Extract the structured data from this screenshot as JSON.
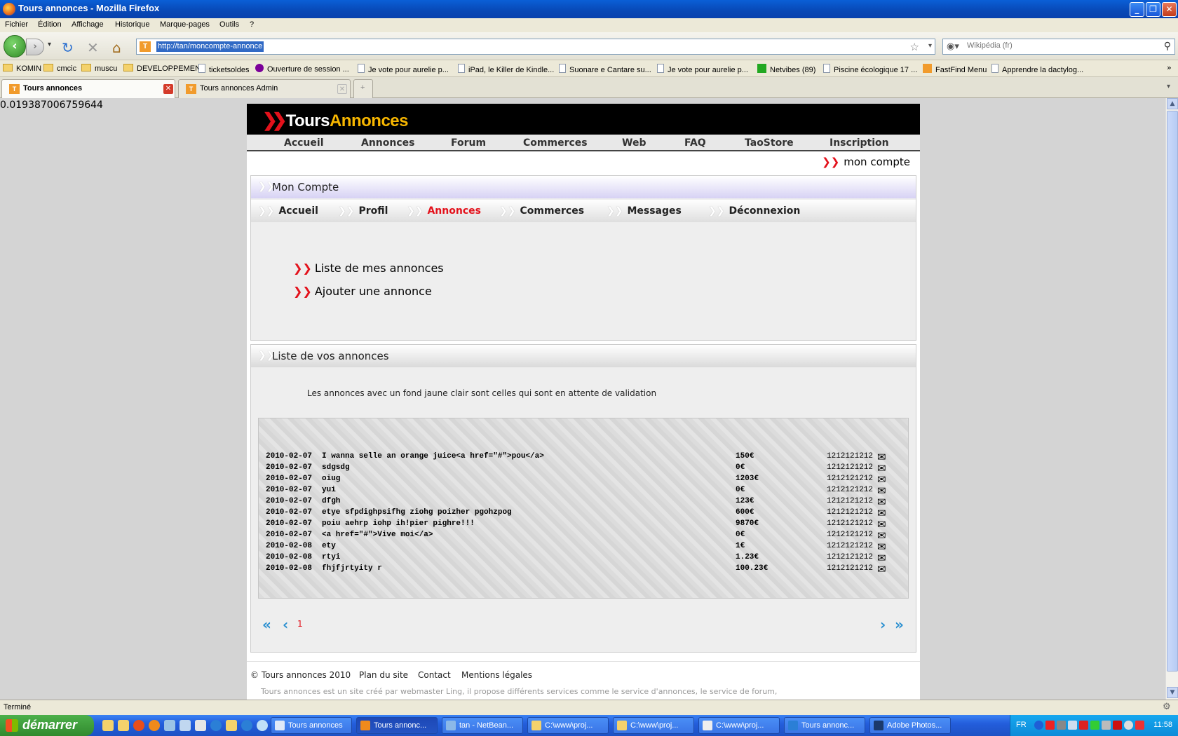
{
  "window": {
    "title": "Tours annonces - Mozilla Firefox"
  },
  "menu": [
    "Fichier",
    "Édition",
    "Affichage",
    "Historique",
    "Marque-pages",
    "Outils",
    "?"
  ],
  "nav": {
    "url": "http://tan/moncompte-annonce",
    "search_placeholder": "Wikipédia (fr)"
  },
  "bookmarks": [
    {
      "label": "KOMIN",
      "icon": "folder"
    },
    {
      "label": "cmcic",
      "icon": "folder"
    },
    {
      "label": "muscu",
      "icon": "folder"
    },
    {
      "label": "DEVELOPPEMENT",
      "icon": "folder"
    },
    {
      "label": "ticketsoldes",
      "icon": "page"
    },
    {
      "label": "Ouverture de session ...",
      "icon": "yahoo"
    },
    {
      "label": "Je vote pour aurelie p...",
      "icon": "page"
    },
    {
      "label": "iPad, le Killer de Kindle...",
      "icon": "page"
    },
    {
      "label": "Suonare e Cantare su...",
      "icon": "page"
    },
    {
      "label": "Je vote pour aurelie p...",
      "icon": "page"
    },
    {
      "label": "Netvibes (89)",
      "icon": "plus"
    },
    {
      "label": "Piscine écologique 17 ...",
      "icon": "page"
    },
    {
      "label": "FastFind Menu",
      "icon": "tour"
    },
    {
      "label": "Apprendre la dactylog...",
      "icon": "page"
    }
  ],
  "tabs": [
    {
      "label": "Tours annonces",
      "active": true
    },
    {
      "label": "Tours annonces Admin",
      "active": false
    }
  ],
  "debug_value": "0.019387006759644",
  "site": {
    "logo_part1": "Tours",
    "logo_part2": "Annonces",
    "nav": [
      "Accueil",
      "Annonces",
      "Forum",
      "Commerces",
      "Web",
      "FAQ",
      "TaoStore",
      "Inscription"
    ],
    "mon_compte": "mon compte",
    "account_title": "Mon Compte",
    "subnav": [
      {
        "label": "Accueil",
        "active": false
      },
      {
        "label": "Profil",
        "active": false
      },
      {
        "label": "Annonces",
        "active": true
      },
      {
        "label": "Commerces",
        "active": false
      },
      {
        "label": "Messages",
        "active": false
      },
      {
        "label": "Déconnexion",
        "active": false
      }
    ],
    "links": [
      "Liste de mes annonces",
      "Ajouter une annonce"
    ],
    "list_title": "Liste de vos annonces",
    "list_note": "Les annonces avec un fond jaune clair sont celles qui sont en attente de validation",
    "ads": [
      {
        "date": "2010-02-07",
        "title": "I wanna selle an orange juice<a href=\"#\">pou</a>",
        "price": "150€",
        "phone": "1212121212"
      },
      {
        "date": "2010-02-07",
        "title": "sdgsdg",
        "price": "0€",
        "phone": "1212121212"
      },
      {
        "date": "2010-02-07",
        "title": "oiug",
        "price": "1203€",
        "phone": "1212121212"
      },
      {
        "date": "2010-02-07",
        "title": "yui",
        "price": "0€",
        "phone": "1212121212"
      },
      {
        "date": "2010-02-07",
        "title": "dfgh",
        "price": "123€",
        "phone": "1212121212"
      },
      {
        "date": "2010-02-07",
        "title": "etye sfpdighpsifhg ziohg poizher pgohzpog",
        "price": "600€",
        "phone": "1212121212"
      },
      {
        "date": "2010-02-07",
        "title": "poiu aehrp iohp ih!pier pighre!!!",
        "price": "9870€",
        "phone": "1212121212"
      },
      {
        "date": "2010-02-07",
        "title": "<a href=\"#\">Vive moi</a>",
        "price": "0€",
        "phone": "1212121212"
      },
      {
        "date": "2010-02-08",
        "title": "ety",
        "price": "1€",
        "phone": "1212121212"
      },
      {
        "date": "2010-02-08",
        "title": "rtyi",
        "price": "1.23€",
        "phone": "1212121212"
      },
      {
        "date": "2010-02-08",
        "title": "fhjfjrtyity r",
        "price": "100.23€",
        "phone": "1212121212"
      }
    ],
    "pager": {
      "first": "«",
      "prev": "‹",
      "page": "1",
      "next": "›",
      "last": "»"
    },
    "footer": {
      "copyright": "© Tours annonces 2010",
      "links": [
        "Plan du site",
        "Contact",
        "Mentions légales"
      ],
      "note": "Tours annonces est un site créé par webmaster Ling, il propose différents services comme le service d'annonces, le service de forum,"
    }
  },
  "status": "Terminé",
  "taskbar": {
    "start": "démarrer",
    "tasks": [
      {
        "label": "Tours annonces",
        "active": false
      },
      {
        "label": "Tours annonc...",
        "active": true
      },
      {
        "label": "tan - NetBean...",
        "active": false
      },
      {
        "label": "C:\\www\\proj...",
        "active": false
      },
      {
        "label": "C:\\www\\proj...",
        "active": false
      },
      {
        "label": "C:\\www\\proj...",
        "active": false
      },
      {
        "label": "Tours annonc...",
        "active": false
      },
      {
        "label": "Adobe Photos...",
        "active": false
      }
    ],
    "lang": "FR",
    "clock": "11:58"
  }
}
